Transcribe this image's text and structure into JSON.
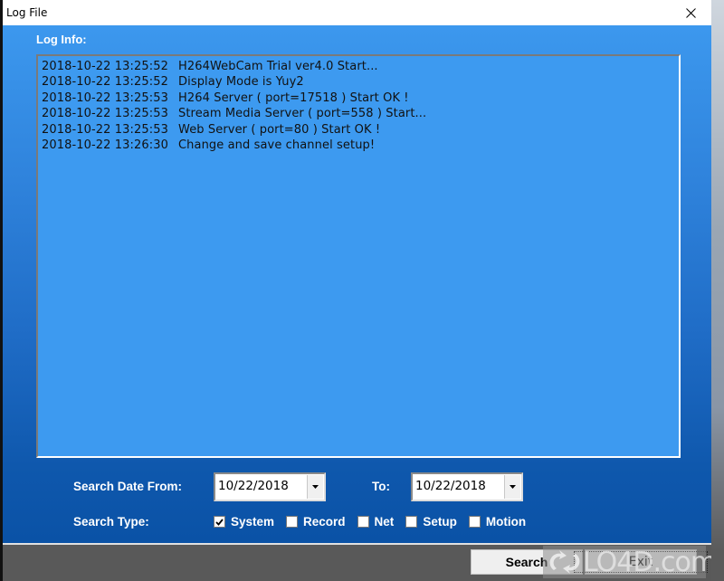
{
  "window": {
    "title": "Log File",
    "close_icon": "close-icon"
  },
  "log": {
    "label": "Log Info:",
    "entries": [
      {
        "timestamp": "2018-10-22 13:25:52",
        "message": "H264WebCam Trial ver4.0 Start..."
      },
      {
        "timestamp": "2018-10-22 13:25:52",
        "message": "Display Mode is Yuy2"
      },
      {
        "timestamp": "2018-10-22 13:25:53",
        "message": "H264 Server ( port=17518 ) Start OK !"
      },
      {
        "timestamp": "2018-10-22 13:25:53",
        "message": "Stream Media Server ( port=558 ) Start..."
      },
      {
        "timestamp": "2018-10-22 13:25:53",
        "message": "Web Server ( port=80 ) Start OK !"
      },
      {
        "timestamp": "2018-10-22 13:26:30",
        "message": "Change and save channel setup!"
      }
    ]
  },
  "search": {
    "date_from_label": "Search Date From:",
    "date_from_value": "10/22/2018",
    "date_to_label": "To:",
    "date_to_value": "10/22/2018",
    "type_label": "Search Type:",
    "types": [
      {
        "label": "System",
        "checked": true
      },
      {
        "label": "Record",
        "checked": false
      },
      {
        "label": "Net",
        "checked": false
      },
      {
        "label": "Setup",
        "checked": false
      },
      {
        "label": "Motion",
        "checked": false
      }
    ]
  },
  "buttons": {
    "search_label": "Search",
    "exit_label": "Exit"
  },
  "watermark": {
    "text": "LO4D.com"
  }
}
